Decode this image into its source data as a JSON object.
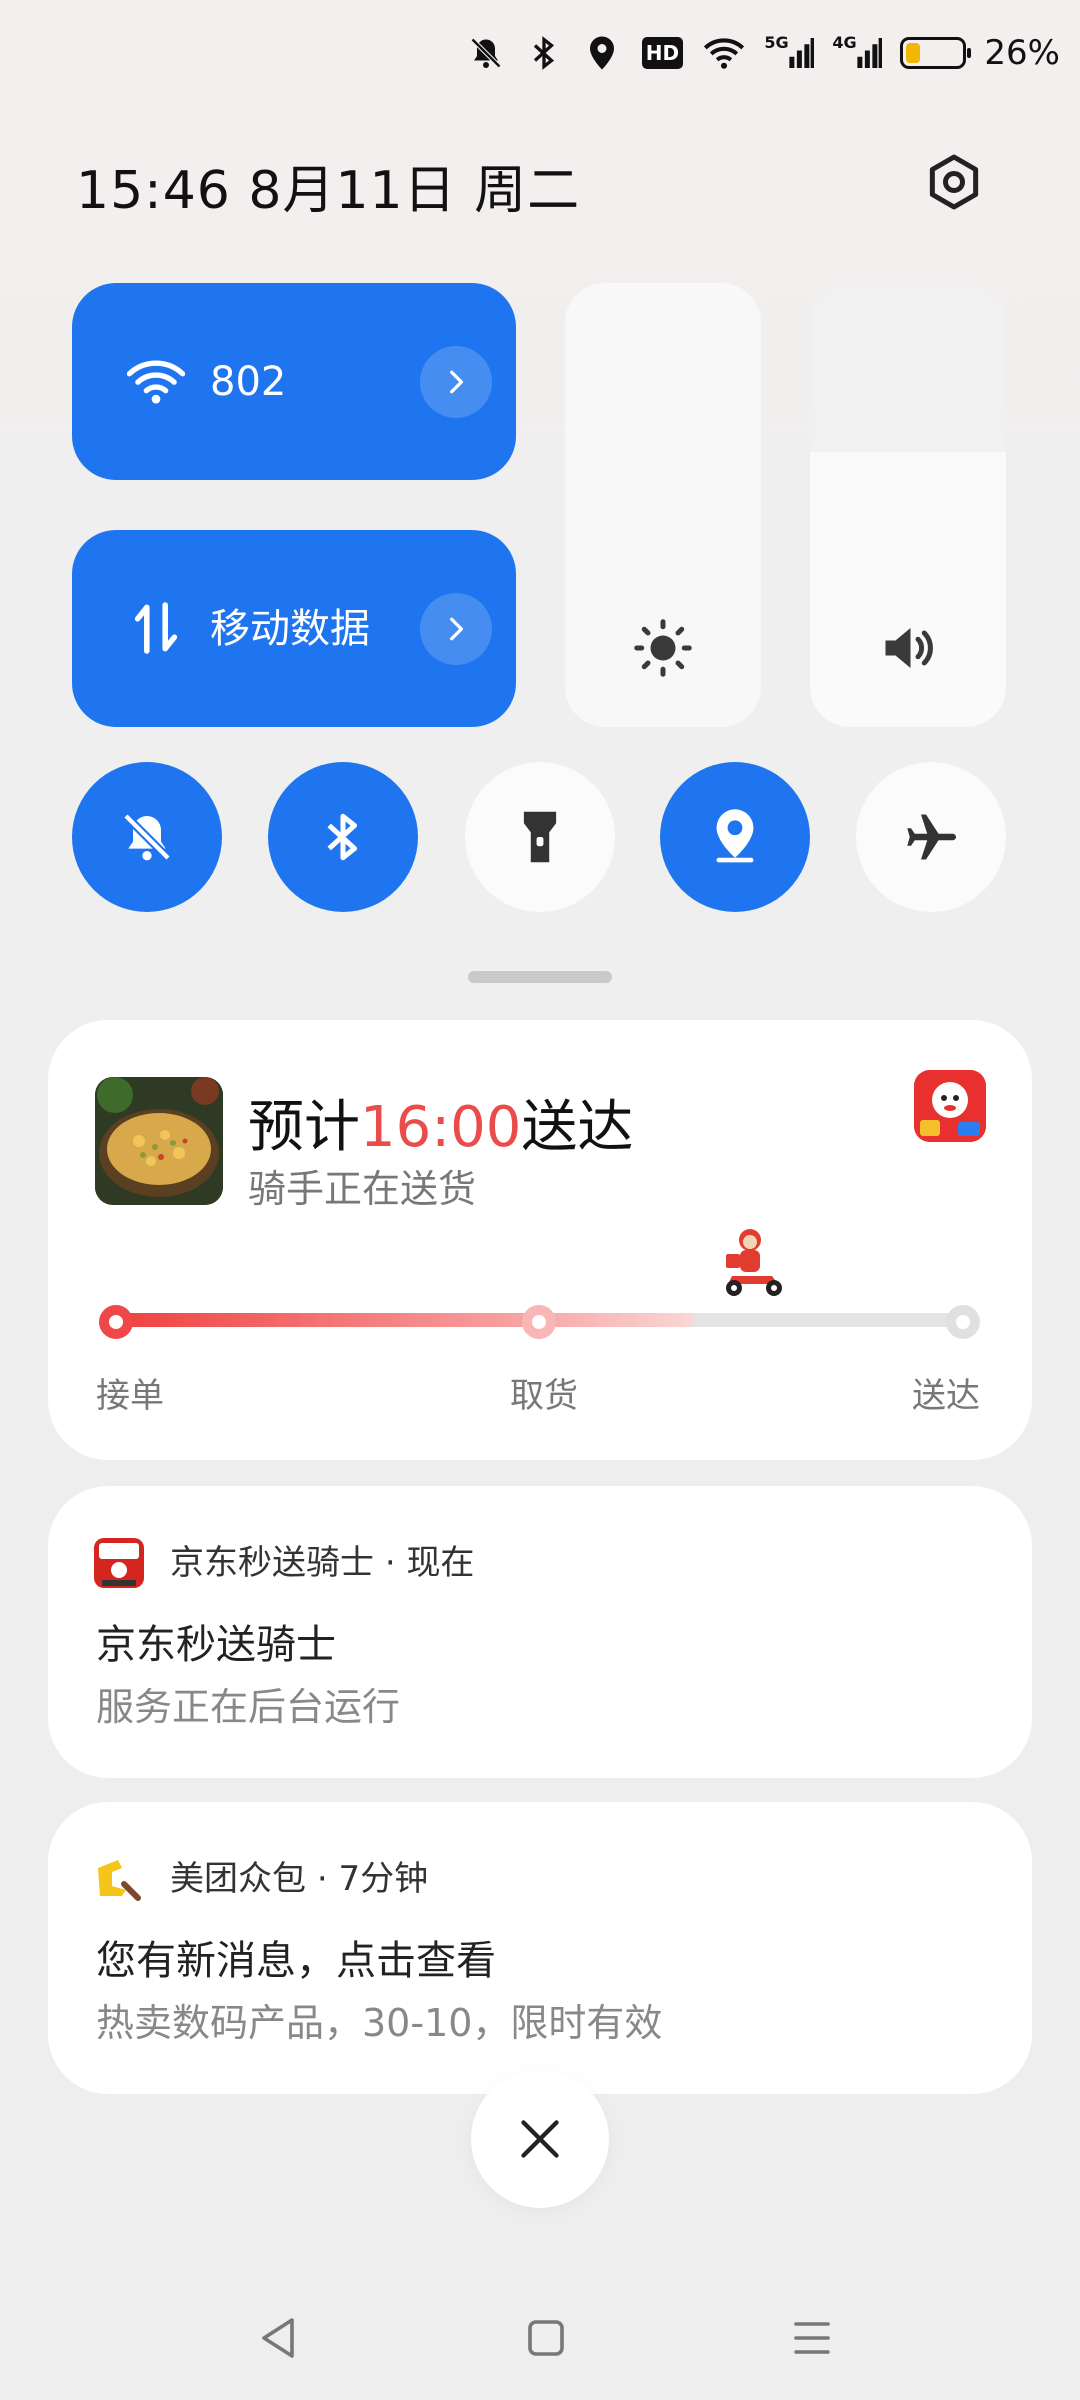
{
  "status_bar": {
    "network_badges": [
      "HD",
      "5G",
      "4G"
    ],
    "battery_level": 0.26,
    "battery_percent": "26%",
    "battery_color": "#f2b705"
  },
  "header": {
    "datetime": "15:46  8月11日  周二",
    "settings_icon": "settings-icon"
  },
  "quick_settings": {
    "wifi": {
      "label": "802",
      "icon": "wifi-icon",
      "enabled": true
    },
    "mobile_data": {
      "label": "移动数据",
      "icon": "data-arrows-icon",
      "enabled": true
    },
    "brightness": {
      "icon": "sun-icon",
      "level": 0.0
    },
    "volume": {
      "icon": "speaker-icon",
      "level": 0.62
    },
    "toggles": [
      {
        "name": "mute",
        "icon": "bell-off-icon",
        "enabled": true
      },
      {
        "name": "bluetooth",
        "icon": "bluetooth-icon",
        "enabled": true
      },
      {
        "name": "flashlight",
        "icon": "flashlight-icon",
        "enabled": false
      },
      {
        "name": "location",
        "icon": "location-icon",
        "enabled": true
      },
      {
        "name": "airplane",
        "icon": "airplane-icon",
        "enabled": false
      }
    ],
    "accent_color": "#1e75ef"
  },
  "delivery": {
    "eta_prefix": "预计",
    "eta_time": "16:00",
    "eta_suffix": "送达",
    "status": "骑手正在送货",
    "progress": 0.68,
    "steps": [
      "接单",
      "取货",
      "送达"
    ],
    "accent_color": "#ea4b4b"
  },
  "notifications": [
    {
      "app": "京东秒送骑士",
      "time": "现在",
      "title": "京东秒送骑士",
      "body": "服务正在后台运行"
    },
    {
      "app": "美团众包",
      "time": "7分钟",
      "title": "您有新消息，点击查看",
      "body": "热卖数码产品，30-10，限时有效"
    }
  ],
  "separator": "·"
}
